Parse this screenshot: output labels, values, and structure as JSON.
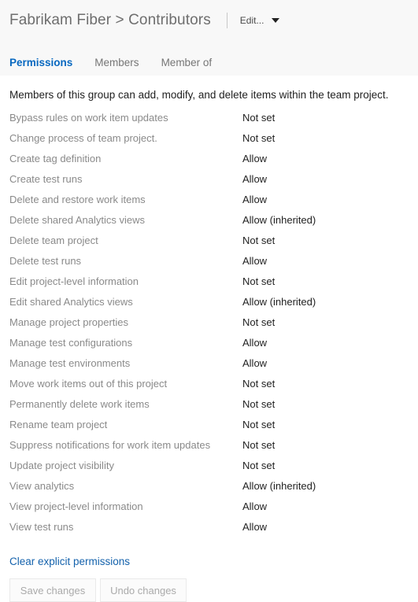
{
  "header": {
    "title": "Fabrikam Fiber > Contributors",
    "edit_menu_label": "Edit...",
    "chevron_icon": "chevron-down-icon"
  },
  "tabs": [
    {
      "label": "Permissions",
      "active": true
    },
    {
      "label": "Members",
      "active": false
    },
    {
      "label": "Member of",
      "active": false
    }
  ],
  "main": {
    "description": "Members of this group can add, modify, and delete items within the team project.",
    "clear_link_label": "Clear explicit permissions",
    "permissions": [
      {
        "name": "Bypass rules on work item updates",
        "value": "Not set"
      },
      {
        "name": "Change process of team project.",
        "value": "Not set"
      },
      {
        "name": "Create tag definition",
        "value": "Allow"
      },
      {
        "name": "Create test runs",
        "value": "Allow"
      },
      {
        "name": "Delete and restore work items",
        "value": "Allow"
      },
      {
        "name": "Delete shared Analytics views",
        "value": "Allow (inherited)"
      },
      {
        "name": "Delete team project",
        "value": "Not set"
      },
      {
        "name": "Delete test runs",
        "value": "Allow"
      },
      {
        "name": "Edit project-level information",
        "value": "Not set"
      },
      {
        "name": "Edit shared Analytics views",
        "value": "Allow (inherited)"
      },
      {
        "name": "Manage project properties",
        "value": "Not set"
      },
      {
        "name": "Manage test configurations",
        "value": "Allow"
      },
      {
        "name": "Manage test environments",
        "value": "Allow"
      },
      {
        "name": "Move work items out of this project",
        "value": "Not set"
      },
      {
        "name": "Permanently delete work items",
        "value": "Not set"
      },
      {
        "name": "Rename team project",
        "value": "Not set"
      },
      {
        "name": "Suppress notifications for work item updates",
        "value": "Not set"
      },
      {
        "name": "Update project visibility",
        "value": "Not set"
      },
      {
        "name": "View analytics",
        "value": "Allow (inherited)"
      },
      {
        "name": "View project-level information",
        "value": "Allow"
      },
      {
        "name": "View test runs",
        "value": "Allow"
      }
    ],
    "buttons": [
      {
        "label": "Save changes"
      },
      {
        "label": "Undo changes"
      }
    ]
  },
  "colors": {
    "accent": "#0868c0",
    "link": "#1462ac",
    "header_background": "#f8f8f8",
    "title_text": "#6e6e6e",
    "permission_name_text": "#8a8a8a",
    "permission_value_text": "#1f1f1f"
  }
}
